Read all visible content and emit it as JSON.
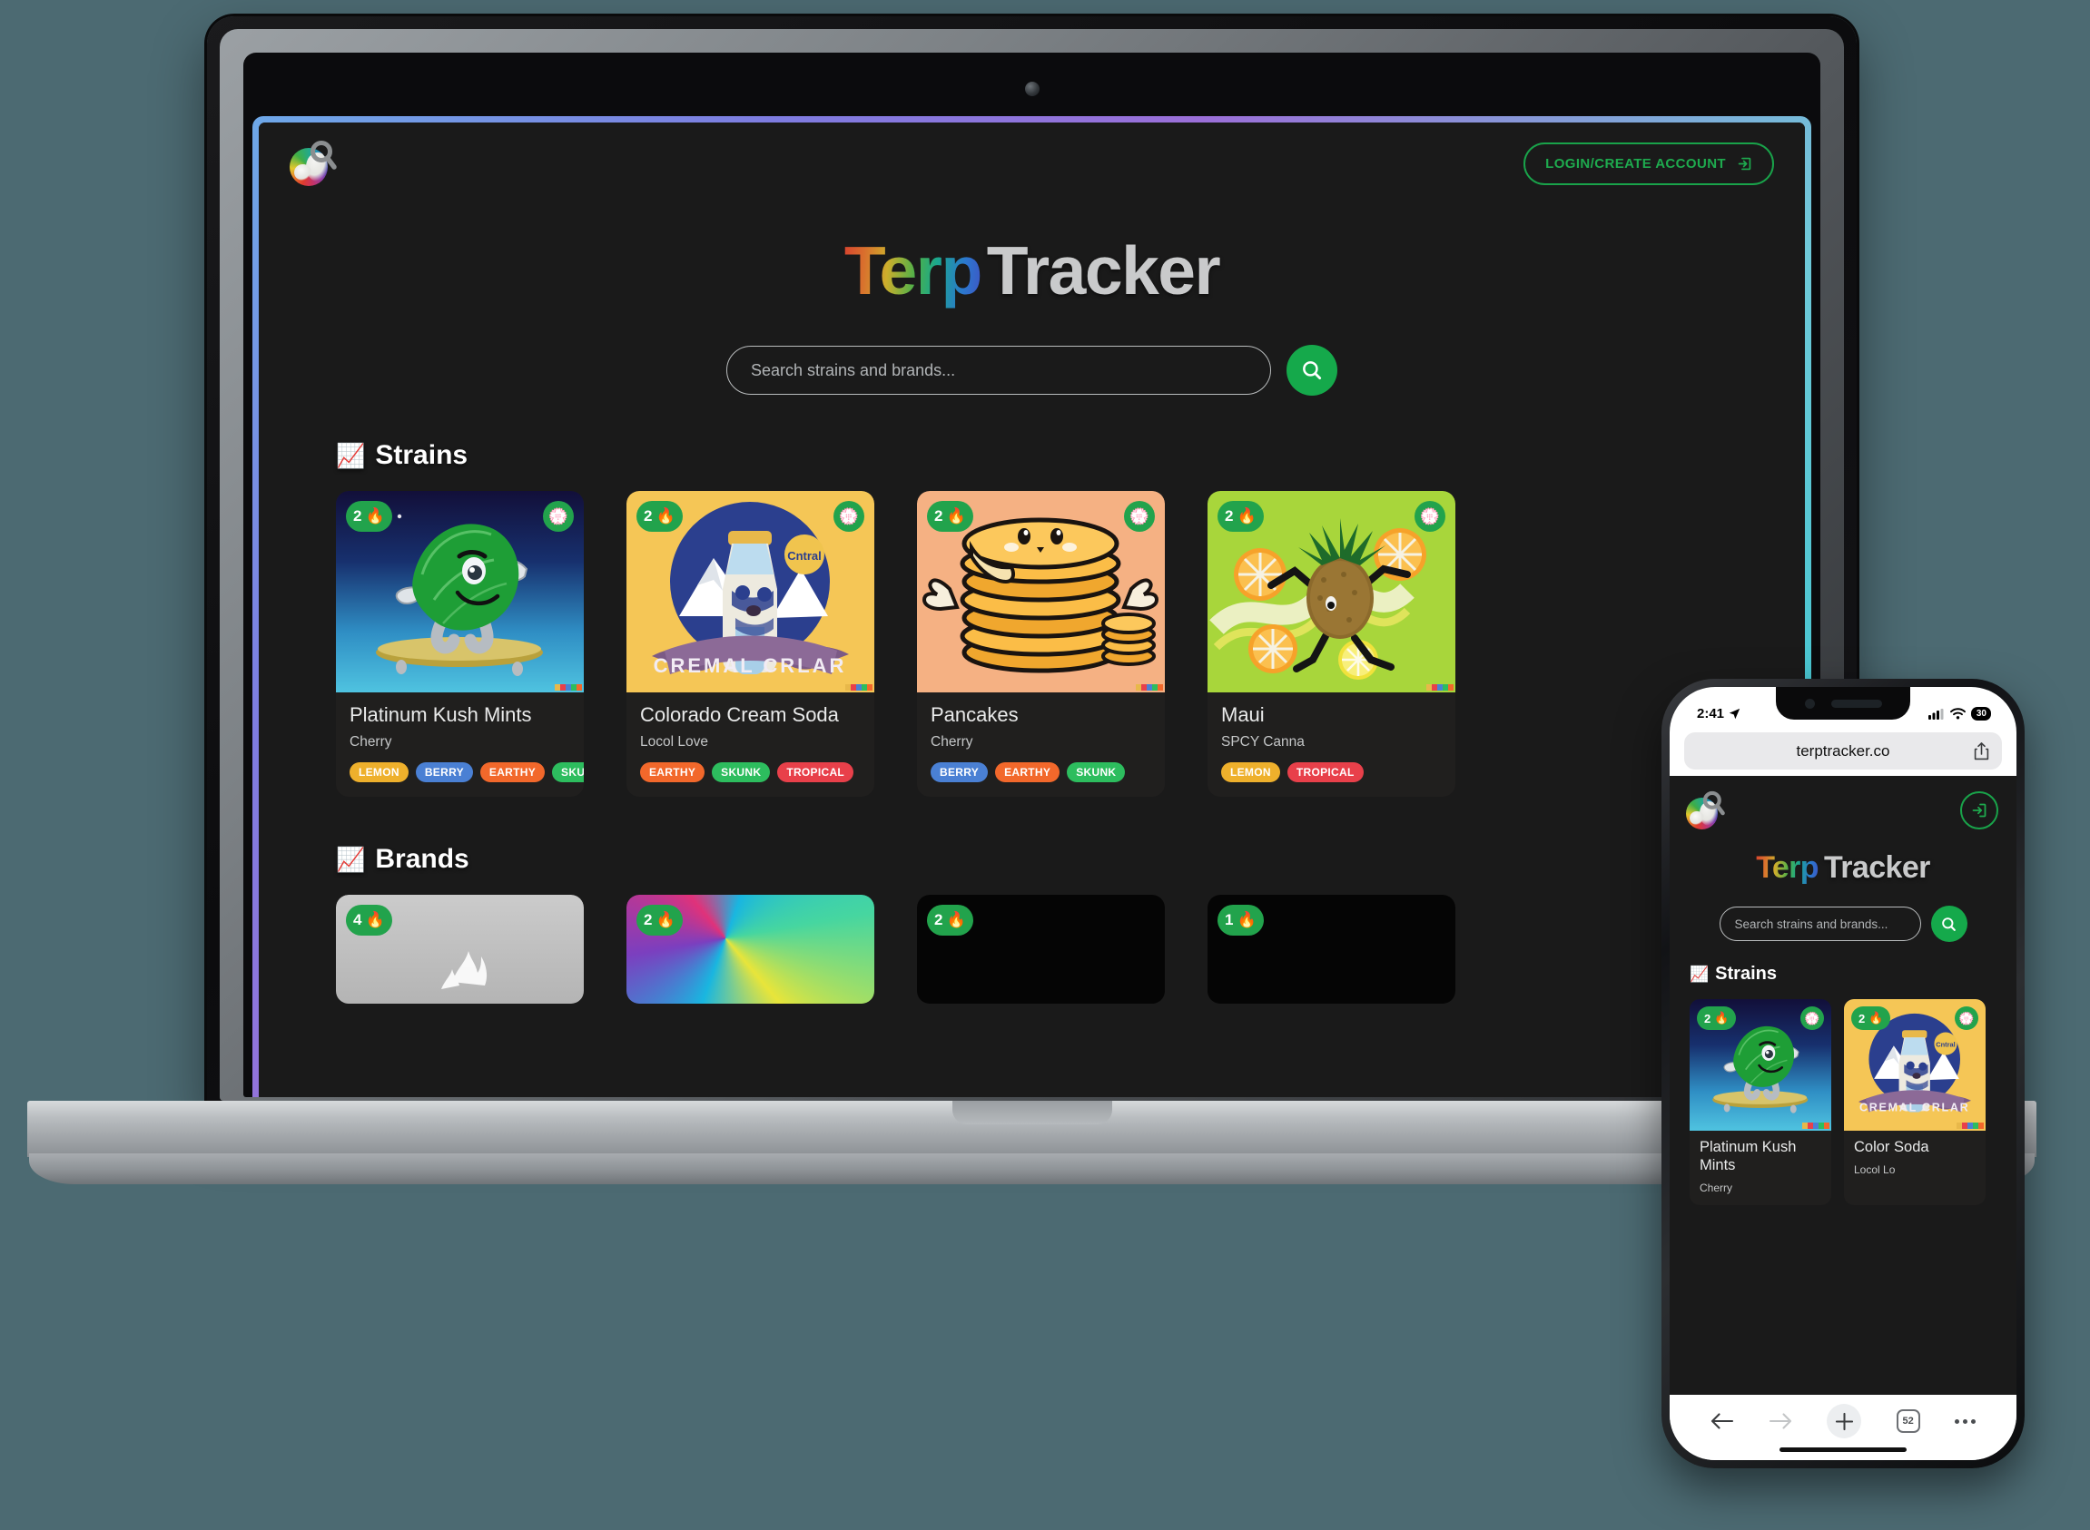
{
  "site": {
    "name": "TerpTracker",
    "brand_part1": "Terp",
    "brand_part2": "Tracker",
    "url": "terptracker.co"
  },
  "desktop": {
    "login_button": "LOGIN/CREATE ACCOUNT",
    "search_placeholder": "Search strains and brands...",
    "search_value": "",
    "sections": [
      {
        "emoji": "📈",
        "title": "Strains"
      },
      {
        "emoji": "📈",
        "title": "Brands"
      }
    ],
    "strains": [
      {
        "name": "Platinum Kush Mints",
        "brand": "Cherry",
        "fire_count": "2",
        "fire_emoji": "🔥",
        "flower_emoji": "💮",
        "tags": [
          {
            "label": "LEMON",
            "color": "#eeb02c"
          },
          {
            "label": "BERRY",
            "color": "#4a80d4"
          },
          {
            "label": "EARTHY",
            "color": "#f2682b"
          },
          {
            "label": "SKUNK",
            "color": "#2dbd5e"
          }
        ]
      },
      {
        "name": "Colorado Cream Soda",
        "brand": "Locol Love",
        "fire_count": "2",
        "fire_emoji": "🔥",
        "flower_emoji": "💮",
        "tags": [
          {
            "label": "EARTHY",
            "color": "#f2682b"
          },
          {
            "label": "SKUNK",
            "color": "#2dbd5e"
          },
          {
            "label": "TROPICAL",
            "color": "#e8404a"
          }
        ]
      },
      {
        "name": "Pancakes",
        "brand": "Cherry",
        "fire_count": "2",
        "fire_emoji": "🔥",
        "flower_emoji": "💮",
        "tags": [
          {
            "label": "BERRY",
            "color": "#4a80d4"
          },
          {
            "label": "EARTHY",
            "color": "#f2682b"
          },
          {
            "label": "SKUNK",
            "color": "#2dbd5e"
          }
        ]
      },
      {
        "name": "Maui",
        "brand": "SPCY Canna",
        "fire_count": "2",
        "fire_emoji": "🔥",
        "flower_emoji": "💮",
        "tags": [
          {
            "label": "LEMON",
            "color": "#eeb02c"
          },
          {
            "label": "TROPICAL",
            "color": "#e8404a"
          }
        ]
      }
    ],
    "brands": [
      {
        "fire_count": "4",
        "fire_emoji": "🔥"
      },
      {
        "fire_count": "2",
        "fire_emoji": "🔥"
      },
      {
        "fire_count": "2",
        "fire_emoji": "🔥"
      },
      {
        "fire_count": "1",
        "fire_emoji": "🔥"
      }
    ]
  },
  "phone": {
    "status": {
      "time": "2:41",
      "battery": "30"
    },
    "url": "terptracker.co",
    "search_placeholder": "Search strains and brands...",
    "section_title": "Strains",
    "section_emoji": "📈",
    "brand_part1": "Terp",
    "brand_part2": "Tracker",
    "cards": [
      {
        "name": "Platinum Kush Mints",
        "brand": "Cherry",
        "fire_count": "2",
        "fire_emoji": "🔥",
        "flower_emoji": "💮"
      },
      {
        "name": "Color Soda",
        "brand": "Locol Lo",
        "fire_count": "2",
        "fire_emoji": "🔥",
        "flower_emoji": "💮"
      }
    ],
    "toolbar": {
      "tab_count": "52"
    }
  },
  "colors": {
    "accent_green": "#15a94b",
    "background": "#4c6a72",
    "card_bg": "#201f1e",
    "app_bg": "#1a1a1a"
  }
}
